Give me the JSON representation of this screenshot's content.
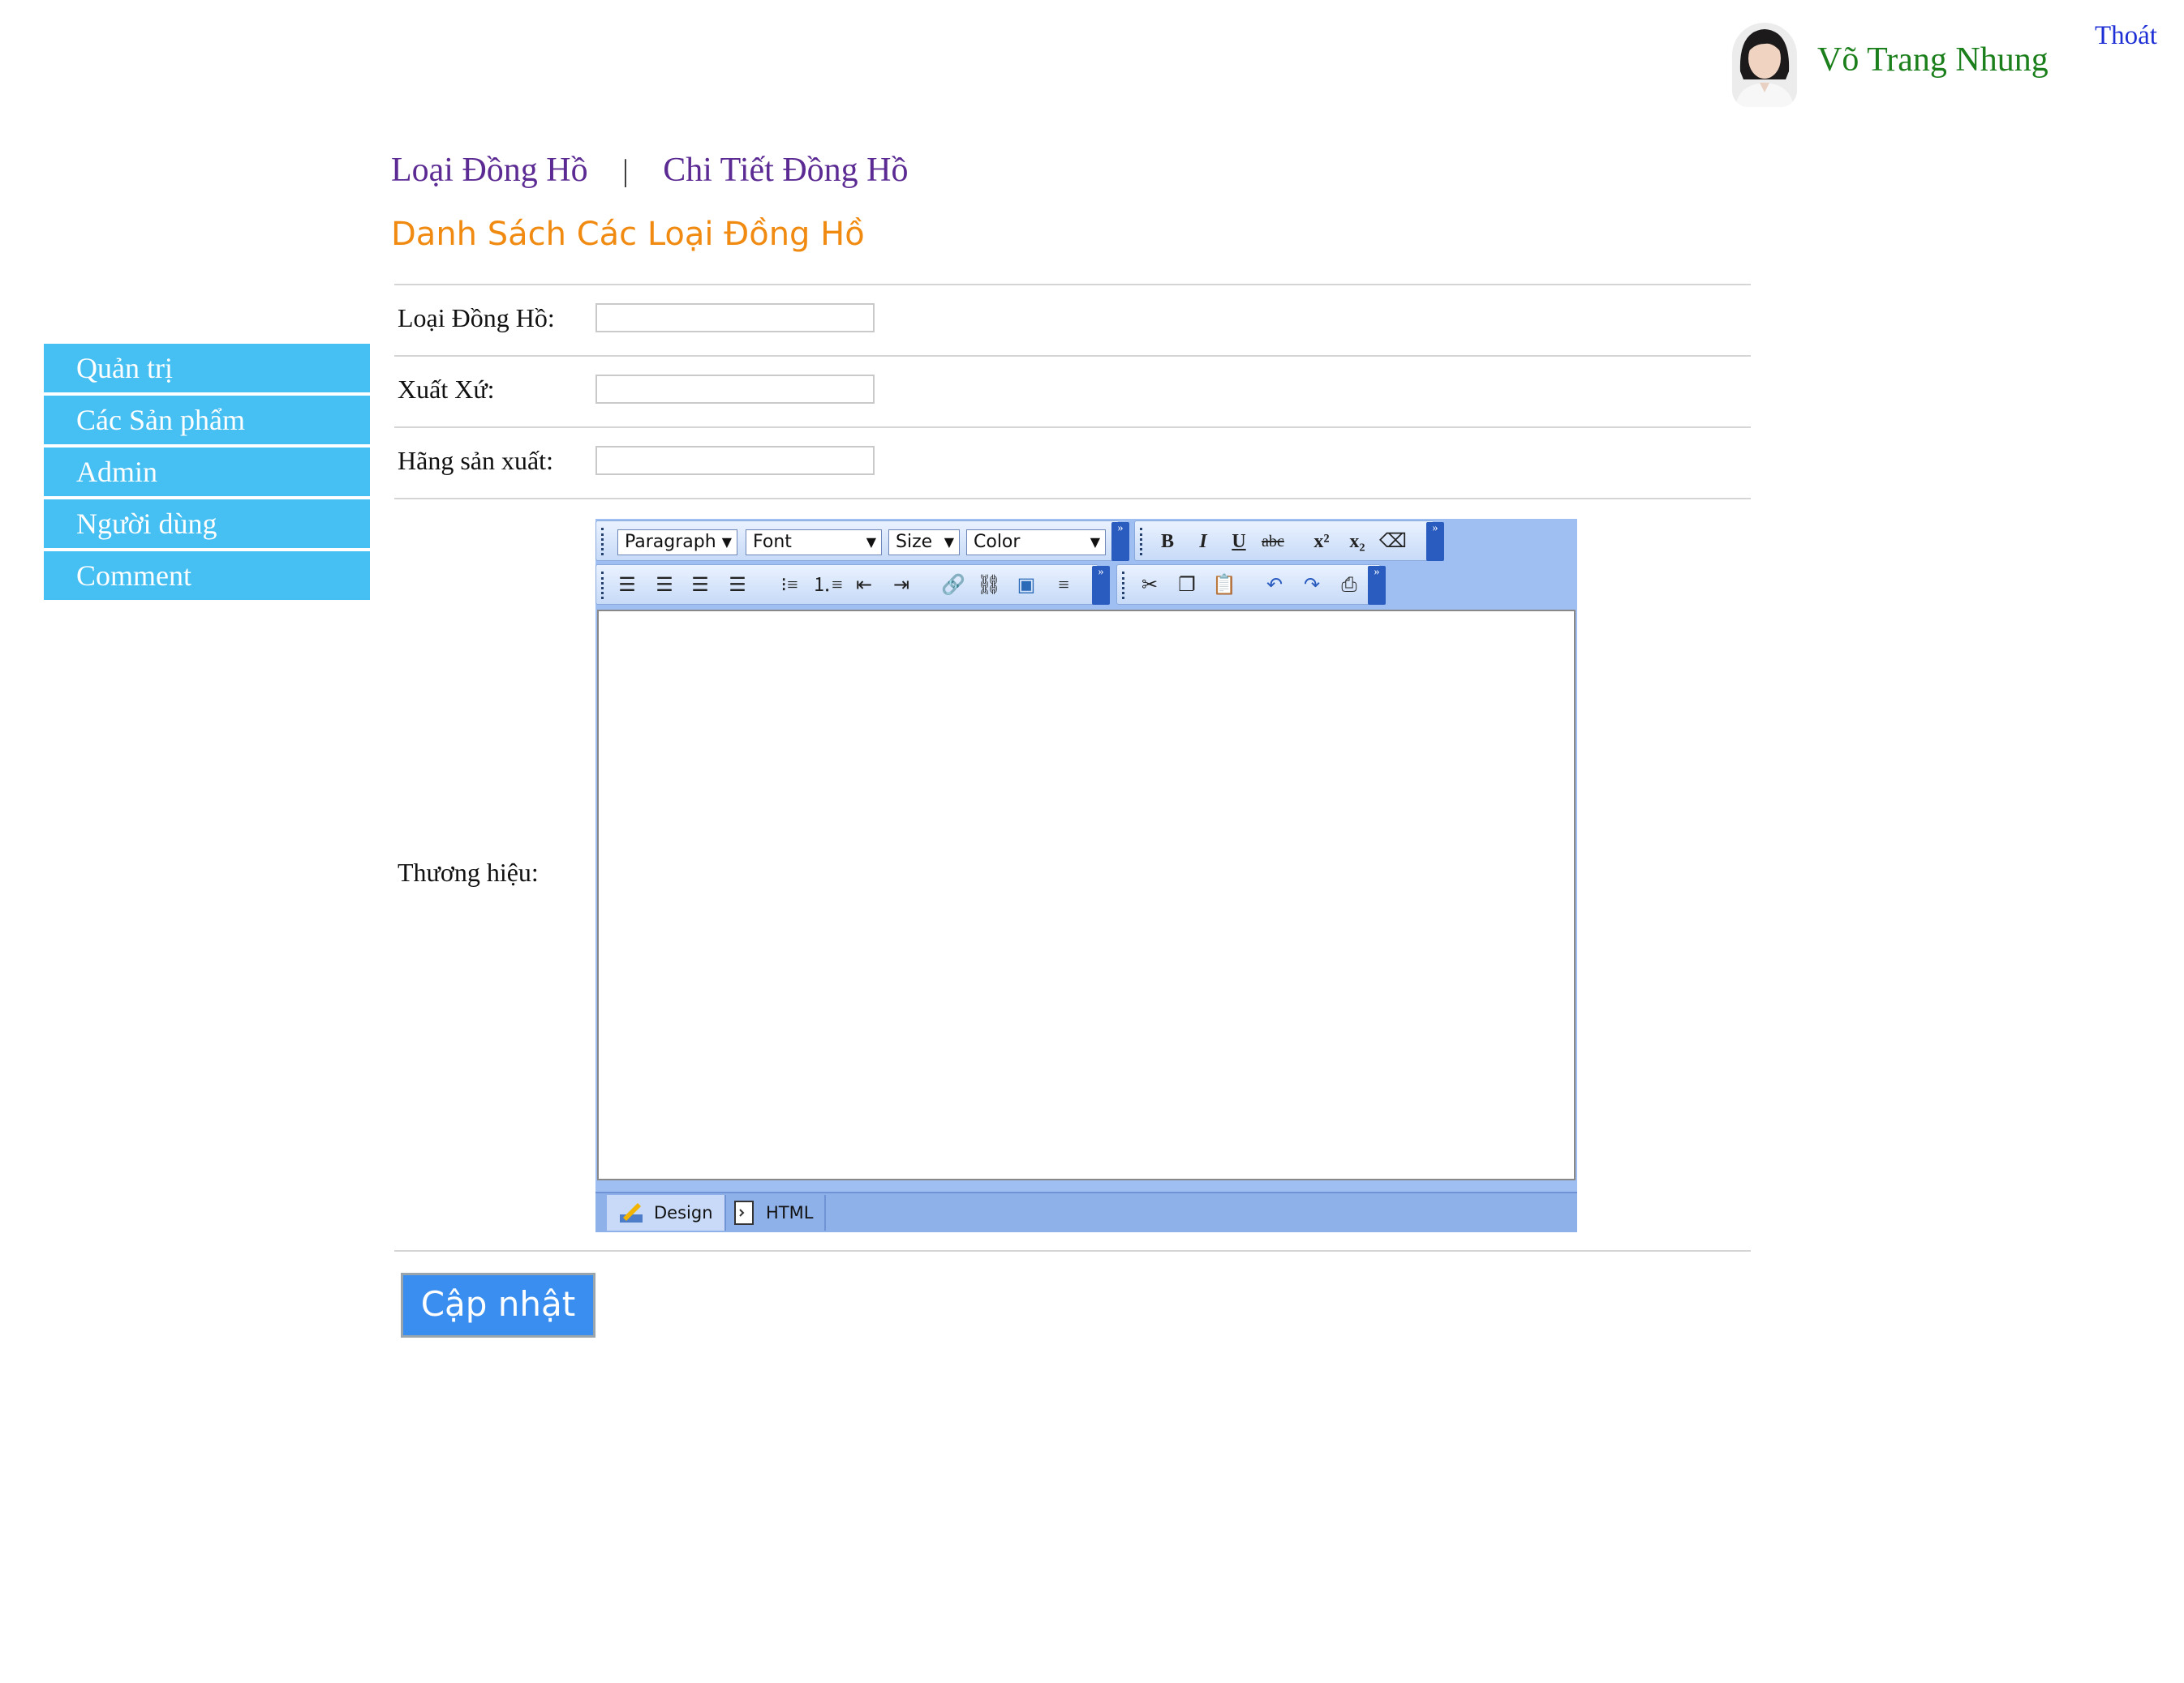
{
  "header": {
    "user_name": "Võ Trang Nhung",
    "logout_label": "Thoát"
  },
  "top_nav": {
    "link_1": "Loại Đồng Hồ",
    "separator": "|",
    "link_2": "Chi Tiết Đồng Hồ"
  },
  "page_title": "Danh Sách Các Loại Đồng Hồ",
  "sidebar": {
    "items": [
      {
        "label": "Quản trị"
      },
      {
        "label": "Các Sản phẩm"
      },
      {
        "label": "Admin"
      },
      {
        "label": "Người dùng"
      },
      {
        "label": "Comment"
      }
    ]
  },
  "form": {
    "type_label": "Loại Đồng Hồ:",
    "type_value": "",
    "origin_label": "Xuất Xứ:",
    "origin_value": "",
    "maker_label": "Hãng sản xuất:",
    "maker_value": "",
    "brand_label": "Thương hiệu:"
  },
  "editor": {
    "paragraph": "Paragraph",
    "font": "Font",
    "size": "Size",
    "color": "Color",
    "design_tab": "Design",
    "html_tab": "HTML"
  },
  "update_button": "Cập nhật",
  "colors": {
    "sidebar": "#46bff2",
    "title": "#f08a11",
    "nav": "#5b2a93",
    "button": "#3a8ef0"
  }
}
